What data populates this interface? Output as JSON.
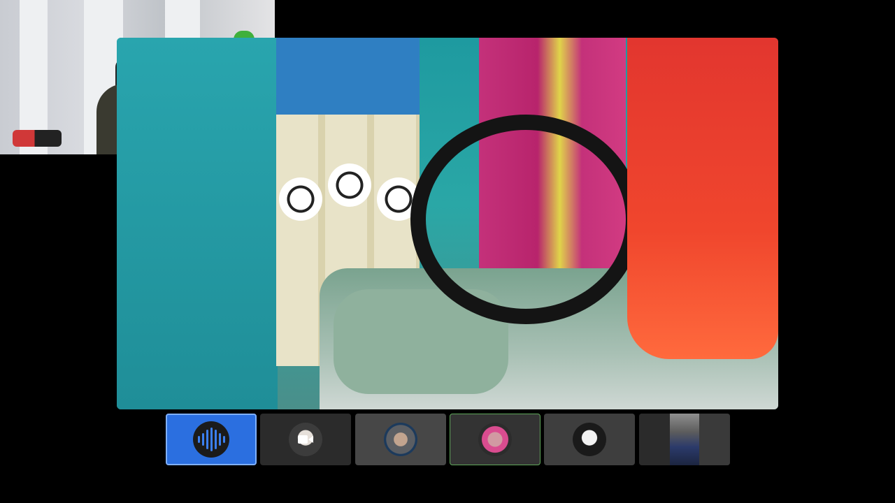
{
  "meeting": {
    "main_speaker": {
      "type": "video-feed"
    },
    "self_view": {
      "type": "video-feed"
    },
    "participants": [
      {
        "id": "p1",
        "state": "active-speaking",
        "display": "voice-icon",
        "accent": "#2b6fe0"
      },
      {
        "id": "p2",
        "state": "camera-off",
        "display": "avatar",
        "overlay_icon": "camera-icon"
      },
      {
        "id": "p3",
        "state": "idle",
        "display": "avatar"
      },
      {
        "id": "p4",
        "state": "speaking",
        "display": "avatar",
        "accent": "#5fa65a"
      },
      {
        "id": "p5",
        "state": "idle",
        "display": "avatar"
      },
      {
        "id": "p6",
        "state": "video-on",
        "display": "video-thumbnail"
      }
    ]
  },
  "colors": {
    "background": "#000000",
    "active_tile": "#2b6fe0",
    "speaking_border": "#5fa65a",
    "tile": "#3a3a3a"
  }
}
